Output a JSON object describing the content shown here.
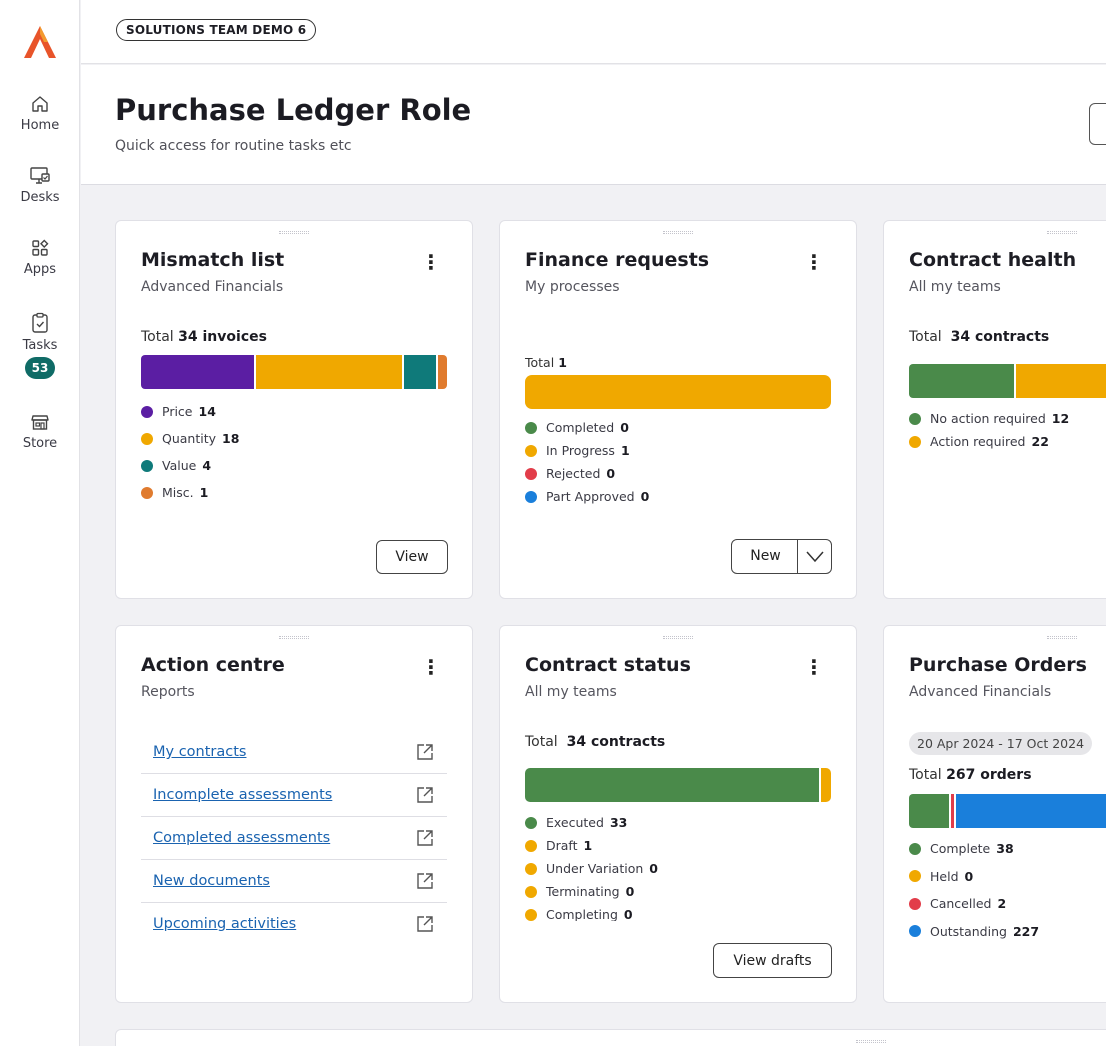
{
  "colors": {
    "purple": "#5b1ea3",
    "amber": "#f0a800",
    "teal": "#0f7a7a",
    "orange": "#e07b2e",
    "green": "#4a8a4a",
    "red": "#e23d4a",
    "blue": "#1a7fdb",
    "link": "#1a63b0"
  },
  "nav": [
    {
      "label": "Home",
      "icon": "home-icon"
    },
    {
      "label": "Desks",
      "icon": "desks-icon"
    },
    {
      "label": "Apps",
      "icon": "apps-icon"
    },
    {
      "label": "Tasks",
      "icon": "tasks-icon",
      "badge": "53"
    },
    {
      "label": "Store",
      "icon": "store-icon"
    }
  ],
  "environment": "SOLUTIONS TEAM DEMO 6",
  "page": {
    "title": "Purchase Ledger Role",
    "subtitle": "Quick access for routine tasks etc"
  },
  "mismatch": {
    "title": "Mismatch list",
    "subtitle": "Advanced Financials",
    "total_prefix": "Total",
    "total_value": "34 invoices",
    "legend": [
      {
        "label": "Price",
        "value": "14"
      },
      {
        "label": "Quantity",
        "value": "18"
      },
      {
        "label": "Value",
        "value": "4"
      },
      {
        "label": "Misc.",
        "value": "1"
      }
    ],
    "button": "View"
  },
  "finance": {
    "title": "Finance requests",
    "subtitle": "My processes",
    "total_prefix": "Total",
    "total_value": "1",
    "legend": [
      {
        "label": "Completed",
        "value": "0"
      },
      {
        "label": "In Progress",
        "value": "1"
      },
      {
        "label": "Rejected",
        "value": "0"
      },
      {
        "label": "Part Approved",
        "value": "0"
      }
    ],
    "button": "New"
  },
  "health": {
    "title": "Contract health",
    "subtitle": "All my teams",
    "total_prefix": "Total",
    "total_value": "34 contracts",
    "legend": [
      {
        "label": "No action required",
        "value": "12"
      },
      {
        "label": "Action required",
        "value": "22"
      }
    ]
  },
  "action": {
    "title": "Action centre",
    "subtitle": "Reports",
    "links": [
      "My contracts",
      "Incomplete assessments",
      "Completed assessments",
      "New documents",
      "Upcoming activities"
    ]
  },
  "status": {
    "title": "Contract status",
    "subtitle": "All my teams",
    "total_prefix": "Total",
    "total_value": "34 contracts",
    "legend": [
      {
        "label": "Executed",
        "value": "33"
      },
      {
        "label": "Draft",
        "value": "1"
      },
      {
        "label": "Under Variation",
        "value": "0"
      },
      {
        "label": "Terminating",
        "value": "0"
      },
      {
        "label": "Completing",
        "value": "0"
      }
    ],
    "button": "View drafts"
  },
  "po": {
    "title": "Purchase Orders",
    "subtitle": "Advanced Financials",
    "date_range": "20 Apr 2024 - 17 Oct 2024",
    "total_prefix": "Total",
    "total_value": "267 orders",
    "legend": [
      {
        "label": "Complete",
        "value": "38"
      },
      {
        "label": "Held",
        "value": "0"
      },
      {
        "label": "Cancelled",
        "value": "2"
      },
      {
        "label": "Outstanding",
        "value": "227"
      }
    ]
  }
}
